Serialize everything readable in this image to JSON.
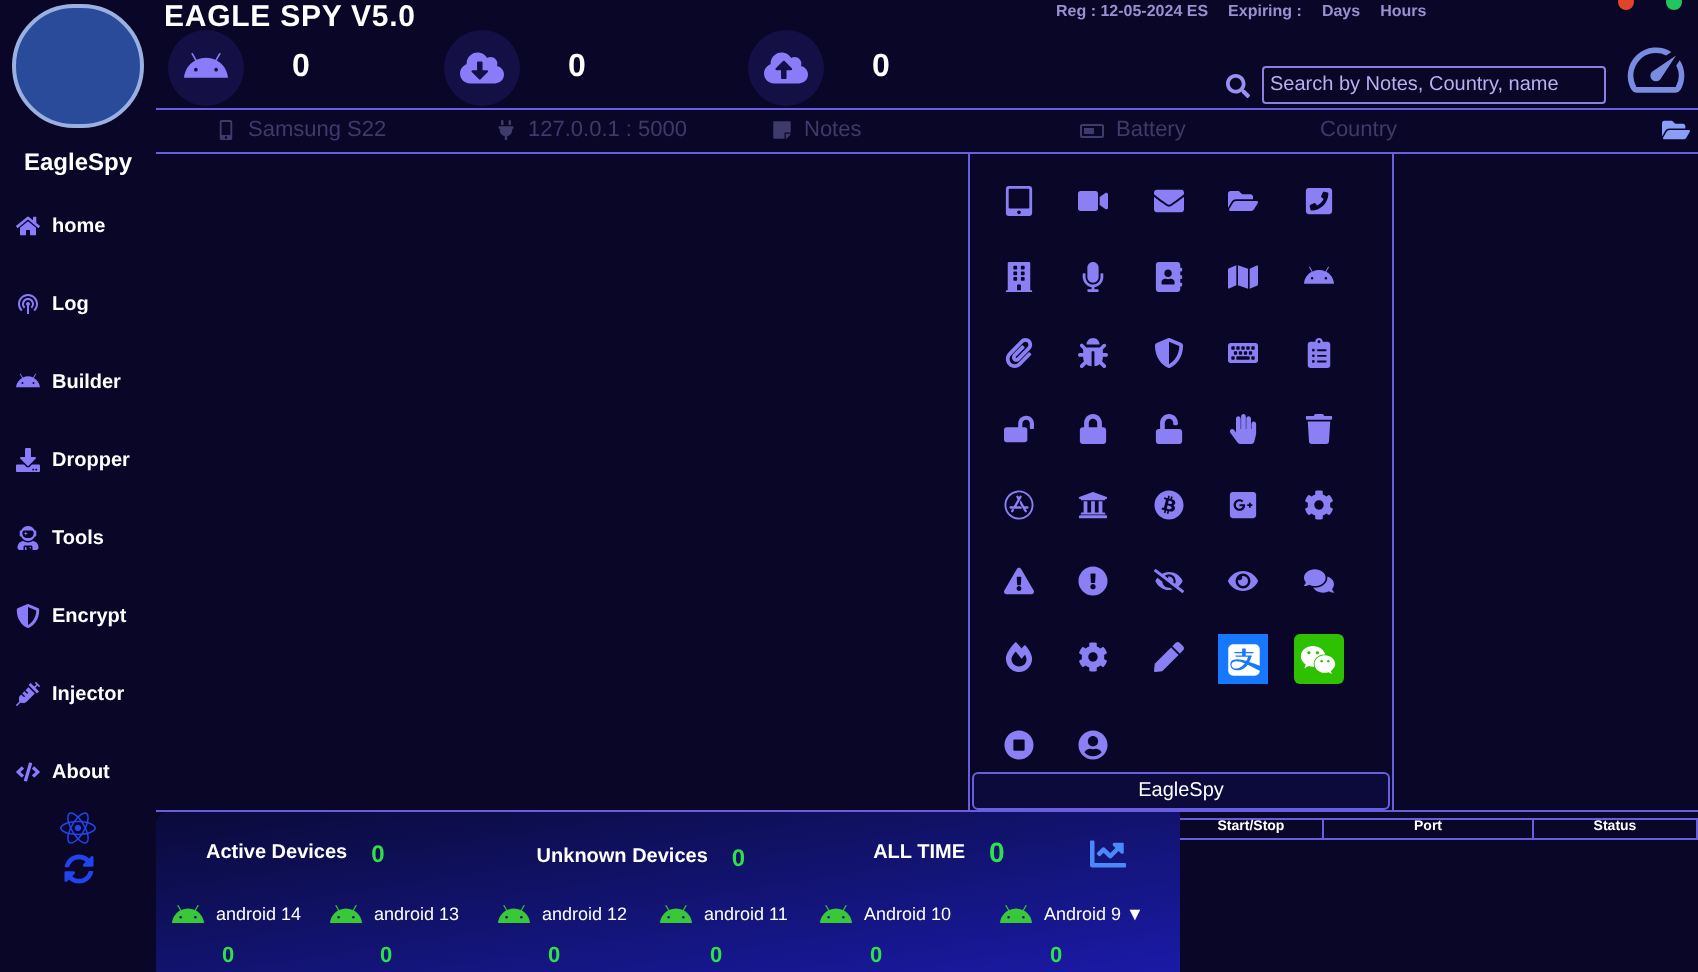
{
  "app": {
    "title": "EAGLE SPY V5.0",
    "brand": "EagleSpy",
    "reg": "Reg : 12-05-2024 ES",
    "expiring": "Expiring :",
    "days": "Days",
    "hours": "Hours"
  },
  "counters": [
    {
      "kind": "android",
      "value": "0"
    },
    {
      "kind": "download",
      "value": "0"
    },
    {
      "kind": "upload",
      "value": "0"
    }
  ],
  "search": {
    "placeholder": "Search by Notes, Country, name"
  },
  "columns": [
    {
      "kind": "phone",
      "label": "Samsung S22"
    },
    {
      "kind": "plug",
      "label": "127.0.0.1 : 5000"
    },
    {
      "kind": "note",
      "label": "Notes"
    },
    {
      "kind": "battery",
      "label": "Battery"
    },
    {
      "kind": "none",
      "label": "Country"
    }
  ],
  "sidebar": {
    "items": [
      {
        "kind": "home",
        "label": "home"
      },
      {
        "kind": "log",
        "label": "Log"
      },
      {
        "kind": "builder",
        "label": "Builder"
      },
      {
        "kind": "dropper",
        "label": "Dropper"
      },
      {
        "kind": "tools",
        "label": "Tools"
      },
      {
        "kind": "encrypt",
        "label": "Encrypt"
      },
      {
        "kind": "injector",
        "label": "Injector"
      },
      {
        "kind": "about",
        "label": "About"
      }
    ]
  },
  "tools_panel": {
    "footer": "EagleSpy"
  },
  "stats": {
    "active_label": "Active Devices",
    "active": "0",
    "unknown_label": "Unknown Devices",
    "unknown": "0",
    "all_time_label": "ALL TIME",
    "all_time": "0",
    "versions": [
      {
        "label": "android 14",
        "count": "0"
      },
      {
        "label": "android 13",
        "count": "0"
      },
      {
        "label": "android 12",
        "count": "0"
      },
      {
        "label": "android 11",
        "count": "0"
      },
      {
        "label": "Android 10",
        "count": "0"
      },
      {
        "label": "Android 9 ▼",
        "count": "0"
      }
    ]
  },
  "ports_table": {
    "columns": [
      "Start/Stop",
      "Port",
      "Status"
    ]
  }
}
